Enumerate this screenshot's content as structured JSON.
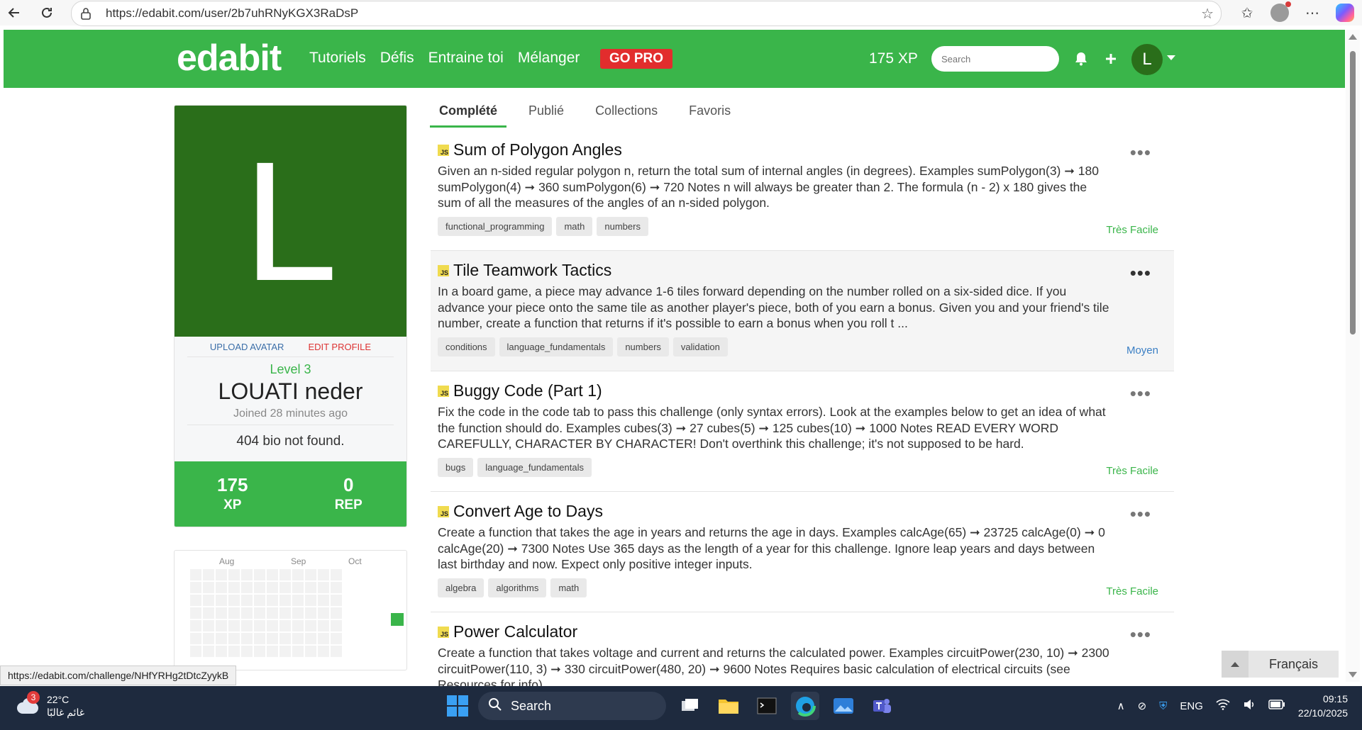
{
  "browser": {
    "url": "https://edabit.com/user/2b7uhRNyKGX3RaDsP"
  },
  "nav": {
    "logo": "edabit",
    "links": [
      "Tutoriels",
      "Défis",
      "Entraine toi",
      "Mélanger"
    ],
    "gopro": "GO PRO",
    "xp": "175 XP",
    "search_placeholder": "Search",
    "avatar_letter": "L"
  },
  "profile": {
    "avatar_letter": "L",
    "upload_avatar": "UPLOAD AVATAR",
    "edit_profile": "EDIT PROFILE",
    "level": "Level 3",
    "name": "LOUATI neder",
    "joined": "Joined 28 minutes ago",
    "bio": "404 bio not found.",
    "xp_value": "175",
    "xp_label": "XP",
    "rep_value": "0",
    "rep_label": "REP"
  },
  "activity": {
    "months": [
      "Aug",
      "Sep",
      "Oct"
    ]
  },
  "tabs": [
    "Complété",
    "Publié",
    "Collections",
    "Favoris"
  ],
  "challenges": [
    {
      "lang": "JS",
      "title": "Sum of Polygon Angles",
      "description": "Given an n-sided regular polygon n, return the total sum of internal angles (in degrees). Examples sumPolygon(3) ➞ 180 sumPolygon(4) ➞ 360 sumPolygon(6) ➞ 720 Notes n will always be greater than 2. The formula (n - 2) x 180 gives the sum of all the measures of the angles of an n-sided polygon.",
      "tags": [
        "functional_programming",
        "math",
        "numbers"
      ],
      "difficulty": "Très Facile"
    },
    {
      "lang": "JS",
      "title": "Tile Teamwork Tactics",
      "description": "In a board game, a piece may advance 1-6 tiles forward depending on the number rolled on a six-sided dice. If you advance your piece onto the same tile as another player's piece, both of you earn a bonus. Given you and your friend's tile number, create a function that returns if it's possible to earn a bonus when you roll t ...",
      "tags": [
        "conditions",
        "language_fundamentals",
        "numbers",
        "validation"
      ],
      "difficulty": "Moyen"
    },
    {
      "lang": "JS",
      "title": "Buggy Code (Part 1)",
      "description": "Fix the code in the code tab to pass this challenge (only syntax errors). Look at the examples below to get an idea of what the function should do. Examples cubes(3) ➞ 27 cubes(5) ➞ 125 cubes(10) ➞ 1000 Notes READ EVERY WORD CAREFULLY, CHARACTER BY CHARACTER! Don't overthink this challenge; it's not supposed to be hard.",
      "tags": [
        "bugs",
        "language_fundamentals"
      ],
      "difficulty": "Très Facile"
    },
    {
      "lang": "JS",
      "title": "Convert Age to Days",
      "description": "Create a function that takes the age in years and returns the age in days. Examples calcAge(65) ➞ 23725 calcAge(0) ➞ 0 calcAge(20) ➞ 7300 Notes Use 365 days as the length of a year for this challenge. Ignore leap years and days between last birthday and now. Expect only positive integer inputs.",
      "tags": [
        "algebra",
        "algorithms",
        "math"
      ],
      "difficulty": "Très Facile"
    },
    {
      "lang": "JS",
      "title": "Power Calculator",
      "description": "Create a function that takes voltage and current and returns the calculated power. Examples circuitPower(230, 10) ➞ 2300 circuitPower(110, 3) ➞ 330 circuitPower(480, 20) ➞ 9600 Notes Requires basic calculation of electrical circuits (see Resources for info).",
      "tags": [],
      "difficulty": ""
    }
  ],
  "language_widget": "Français",
  "status_link": "https://edabit.com/challenge/NHfYRHg2tDtcZyykB",
  "taskbar": {
    "weather_badge": "3",
    "temperature": "22°C",
    "weather_desc": "غائم غالبًا",
    "search": "Search",
    "lang": "ENG",
    "time": "09:15",
    "date": "22/10/2025"
  }
}
